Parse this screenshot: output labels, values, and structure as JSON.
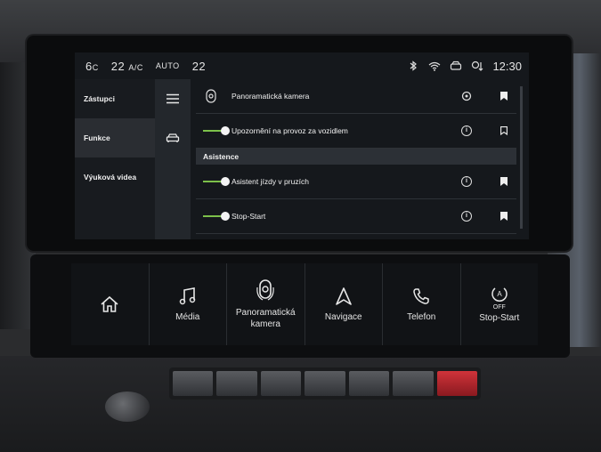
{
  "status_bar": {
    "left_temp": "6",
    "left_temp_unit": "C",
    "fan_value": "22",
    "ac_label": "A/C",
    "auto_label": "AUTO",
    "right_temp": "22",
    "time": "12:30",
    "icons": [
      "bluetooth-icon",
      "wifi-icon",
      "car-connect-icon",
      "signal-icon"
    ]
  },
  "sidebar": {
    "items": [
      {
        "label": "Zástupci",
        "active": false
      },
      {
        "label": "Funkce",
        "active": true
      },
      {
        "label": "Výuková videa",
        "active": false
      }
    ]
  },
  "list": {
    "rows": [
      {
        "label": "Panoramatická kamera",
        "toggle": false,
        "icon": "camera-settings-icon",
        "bookmarked": true
      },
      {
        "label": "Upozornění na provoz za vozidlem",
        "toggle": true,
        "icon": "info-icon",
        "bookmarked": false
      }
    ],
    "section": "Asistence",
    "section_rows": [
      {
        "label": "Asistent jízdy v pruzích",
        "toggle": true,
        "icon": "info-icon",
        "bookmarked": true
      },
      {
        "label": "Stop-Start",
        "toggle": true,
        "icon": "info-icon",
        "bookmarked": true
      }
    ]
  },
  "touch_bar": {
    "buttons": [
      {
        "label": "",
        "icon": "home-icon"
      },
      {
        "label": "Média",
        "icon": "music-icon"
      },
      {
        "label": "Panoramatická kamera",
        "icon": "camera-icon"
      },
      {
        "label": "Navigace",
        "icon": "navigation-icon"
      },
      {
        "label": "Telefon",
        "icon": "phone-icon"
      },
      {
        "label": "Stop-Start",
        "icon": "stop-start-off-icon",
        "badge": "OFF"
      }
    ]
  },
  "colors": {
    "accent_green": "#7cc04a",
    "hazard_red": "#d0333a"
  }
}
